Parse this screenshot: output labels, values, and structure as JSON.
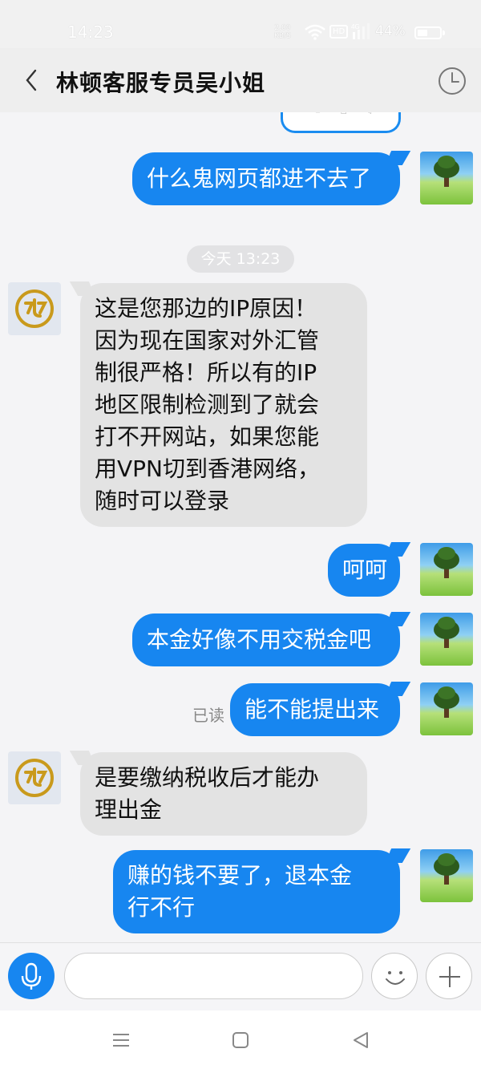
{
  "status_bar": {
    "time": "14:23",
    "net_speed_value": "2.00",
    "net_speed_unit": "KB/S",
    "hd_badge": "HD",
    "network_type": "4G",
    "battery_percent": "44%"
  },
  "header": {
    "title": "林顿客服专员吴小姐"
  },
  "messages": [
    {
      "side": "out",
      "text": "什么鬼网页都进不去了"
    },
    {
      "side": "in",
      "lines": [
        "这是您那边的IP原因！",
        "因为现在国家对外汇管",
        "制很严格！所以有的IP",
        "地区限制检测到了就会",
        "打不开网站，如果您能",
        "用VPN切到香港网络，",
        "随时可以登录"
      ]
    },
    {
      "side": "out",
      "text": "呵呵"
    },
    {
      "side": "out",
      "text": "本金好像不用交税金吧"
    },
    {
      "side": "out",
      "text": "能不能提出来",
      "read_status": "已读"
    },
    {
      "side": "in",
      "lines": [
        "是要缴纳税收后才能办",
        "理出金"
      ]
    },
    {
      "side": "out",
      "lines": [
        "赚的钱不要了，退本金",
        "行不行"
      ]
    }
  ],
  "timestamp_divider": "今天 13:23",
  "input_bar": {
    "placeholder": ""
  },
  "colors": {
    "outgoing_bubble": "#1786f0",
    "incoming_bubble": "#e3e3e3",
    "logo_gold": "#c99a1c"
  },
  "icons": [
    "back-icon",
    "history-icon",
    "microphone-icon",
    "emoji-icon",
    "plus-icon",
    "menu-icon",
    "home-icon",
    "back-triangle-icon"
  ]
}
